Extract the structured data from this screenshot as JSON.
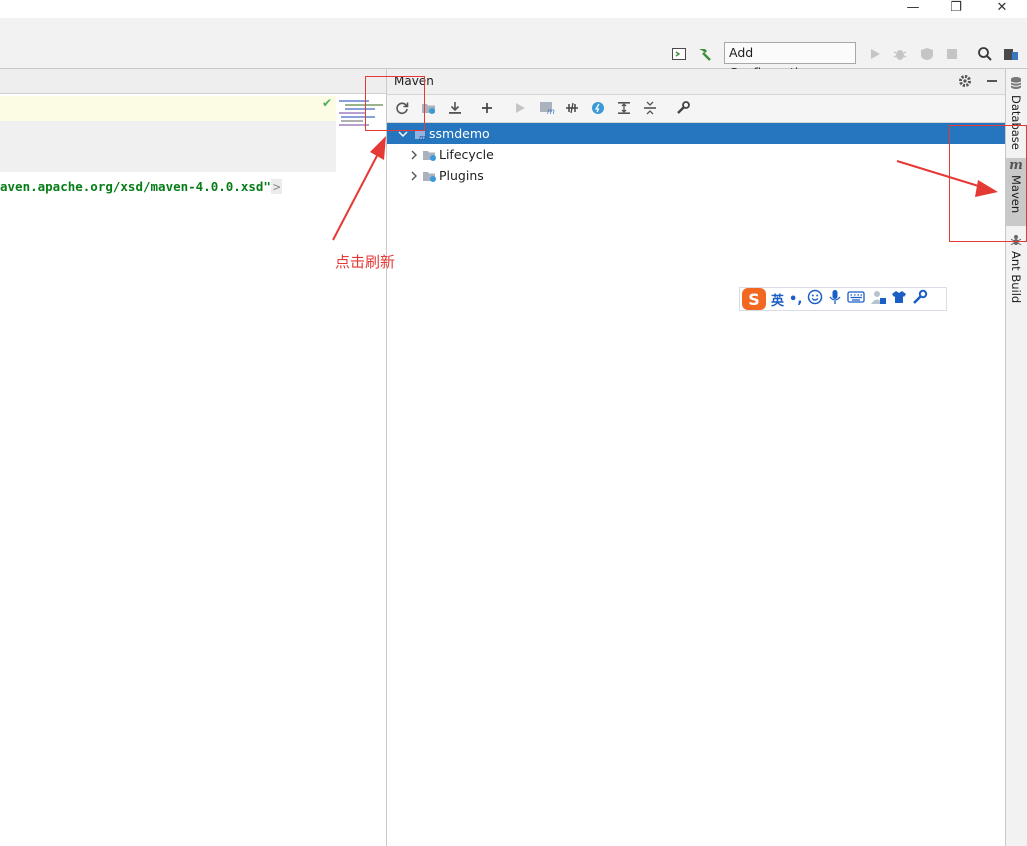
{
  "window": {
    "min": "—",
    "restore": "❐",
    "close": "✕"
  },
  "toolbar": {
    "run_config_label": "Add Configuration..."
  },
  "editor": {
    "code_text": "aven.apache.org/xsd/maven-4.0.0.xsd\"",
    "code_tag_end": ">",
    "inspection_mark": "✔"
  },
  "maven": {
    "title": "Maven",
    "tree": [
      {
        "label": "ssmdemo",
        "selected": true
      },
      {
        "label": "Lifecycle"
      },
      {
        "label": "Plugins"
      }
    ]
  },
  "right_strip": {
    "tabs": [
      "Database",
      "Maven",
      "Ant Build"
    ]
  },
  "annotation": {
    "note": "点击刷新"
  },
  "ime": {
    "mode": "英",
    "punct": "•,"
  }
}
